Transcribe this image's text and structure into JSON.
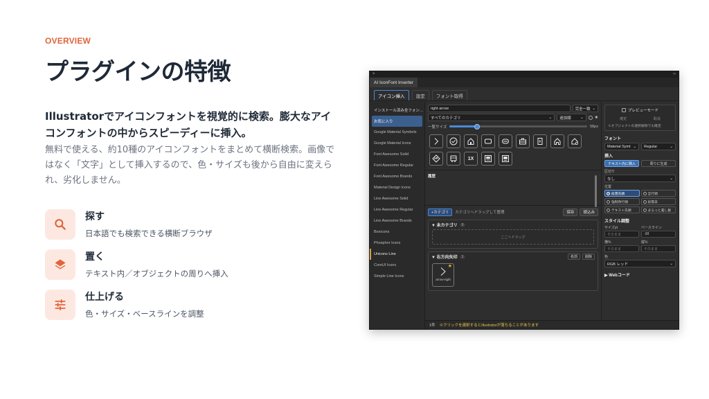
{
  "slide": {
    "eyebrow": "OVERVIEW",
    "title": "プラグインの特徴",
    "lead": "Illustratorでアイコンフォントを視覚的に検索。膨大なアイコンフォントの中からスピーディーに挿入。",
    "description": "無料で使える、約10種のアイコンフォントをまとめて横断検索。画像ではなく「文字」として挿入するので、色・サイズも後から自由に変えられ、劣化しません。",
    "accent_color": "#e0643c",
    "features": [
      {
        "icon": "search-icon",
        "title": "探す",
        "desc": "日本語でも検索できる横断ブラウザ"
      },
      {
        "icon": "layers-icon",
        "title": "置く",
        "desc": "テキスト内／オブジェクトの周りへ挿入"
      },
      {
        "icon": "sliders-icon",
        "title": "仕上げる",
        "desc": "色・サイズ・ベースラインを調整"
      }
    ]
  },
  "app": {
    "close_glyph": "×",
    "collapse_glyph": "‹‹",
    "window_title": "AI IconFont Inserter",
    "tabs": [
      "アイコン挿入",
      "設定",
      "フォント取得"
    ],
    "sidebar": [
      "インストール済み全フォン…",
      "お気に入り",
      "Google Material Symbols",
      "Google Material Icons",
      "Font Awesome Solid",
      "Font Awesome Regular",
      "Font Awesome Brands",
      "Material Design Icons",
      "Line Awesome Solid",
      "Line Awesome Regular",
      "Line Awesome Brands",
      "Boxicons",
      "Phosphor Icons",
      "Unicons Line",
      "CoreUI Icons",
      "Simple Line Icons"
    ],
    "search": {
      "value": "right arrow",
      "match_mode": "完全一致"
    },
    "category": {
      "value": "すべてのカテゴリ",
      "sort": "追加順"
    },
    "star_glyph": "★",
    "size": {
      "label": "一覧サイズ",
      "value": "58px",
      "fraction": 0.2
    },
    "grid_icons": [
      "chevron-right-icon",
      "check-circle-icon",
      "home-icon",
      "rounded-rect-icon",
      "pill-icon",
      "briefcase-icon",
      "door-arrow-icon",
      "home-outline-icon",
      "home-gear-icon",
      "diamond-arrow-icon",
      "bus-icon",
      "1x-icon",
      "image-box-icon",
      "album-icon"
    ],
    "grid_text": {
      "1x": "1X"
    },
    "history_label": "履歴",
    "toolbar": {
      "add_category": "+カテゴリ",
      "hint": "カテゴリヘドラッグして整理",
      "save": "保存",
      "load": "読込み"
    },
    "uncategorized": {
      "title": "▼ 未カテゴリ",
      "count": "0",
      "drop_hint": "ここへドラッグ"
    },
    "right_arrow_group": {
      "title": "▼ 右方向矢印",
      "count": "1",
      "rename": "名前",
      "delete": "削除",
      "item_name": "arrow-right"
    },
    "status": {
      "count": "1件",
      "warning": "※クリックを連射するとIllustratorが落ちることがあります"
    },
    "panel": {
      "preview_mode": "プレビューモード",
      "confirm": "確定",
      "cancel": "取消",
      "preview_note": "※オブジェクトの選択解除でも確定",
      "font_title": "フォント",
      "font_family": "Material Symt",
      "font_style": "Regular",
      "insert_title": "挿入",
      "insert_in_text": "テキスト内に挿入",
      "insert_around": "周りに生成",
      "separator_label": "区切り",
      "separator_value": "なし",
      "position_label": "位置",
      "positions": [
        "段落先頭",
        "全行頭",
        "強制改行頭",
        "段落末",
        "テキスト先頭",
        "まるっと差し替"
      ],
      "style_title": "スタイル調整",
      "size_label": "サイズpt",
      "baseline_label": "ベースライン",
      "size_placeholder": "そのまま",
      "baseline_value": "-10",
      "width_label": "横%",
      "height_label": "縦%",
      "width_placeholder": "そのまま",
      "height_placeholder": "そのまま",
      "color_label": "色",
      "color_value": "RGB レッド",
      "web_code": "▶ Webコード"
    }
  }
}
